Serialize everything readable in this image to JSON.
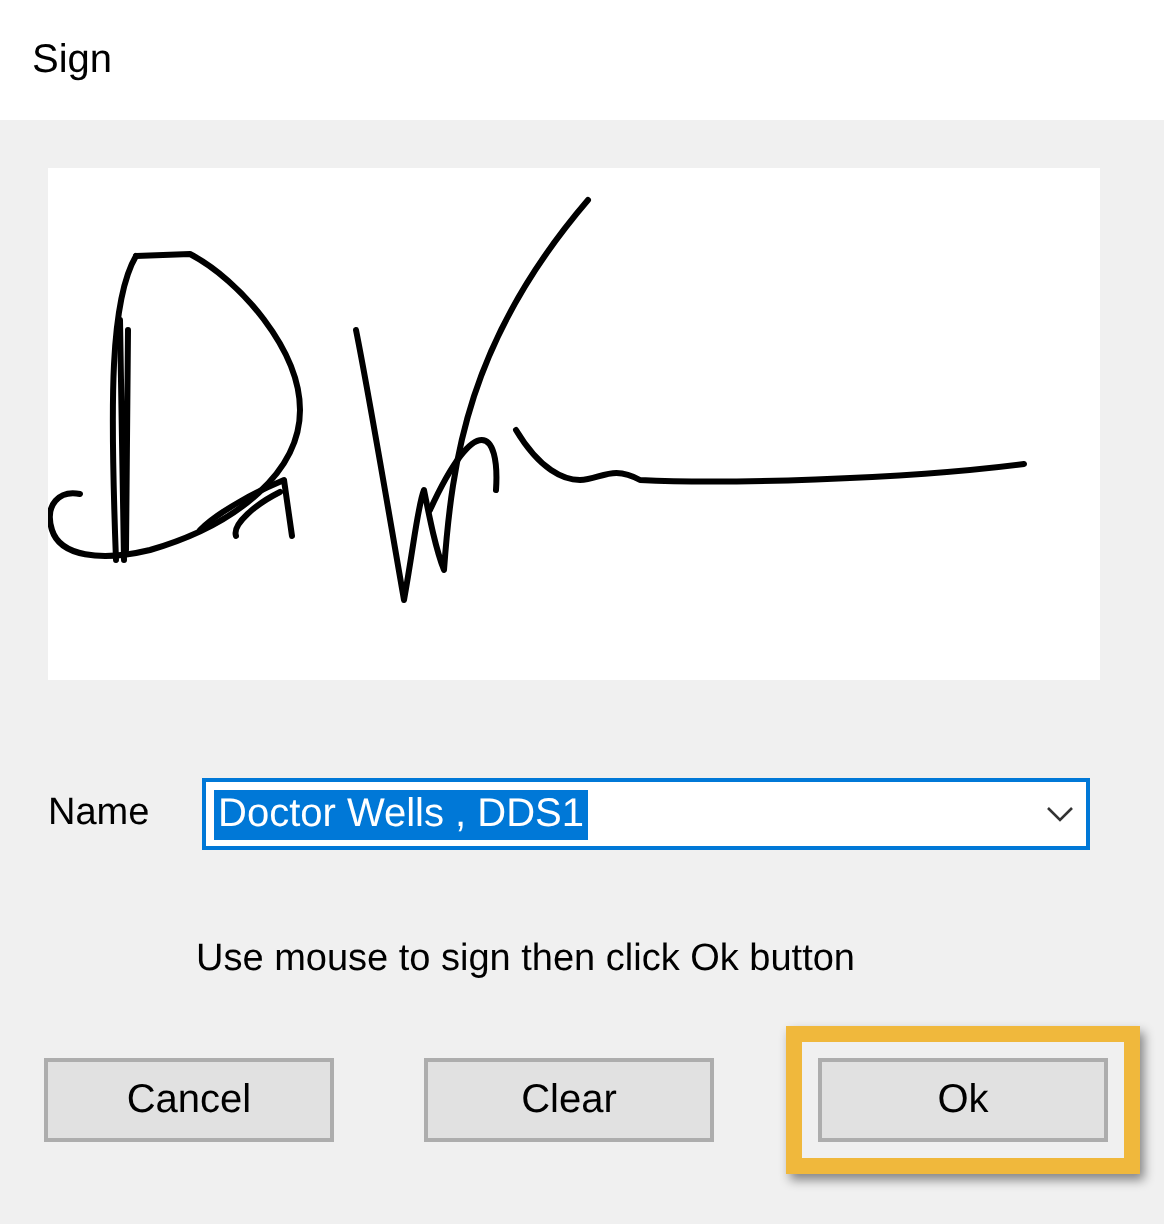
{
  "window": {
    "title": "Sign"
  },
  "name_field": {
    "label": "Name",
    "value": "Doctor Wells , DDS1",
    "text_selected": true,
    "focused": true
  },
  "hint": "Use mouse to sign then click Ok button",
  "buttons": [
    {
      "label": "Cancel",
      "highlighted": false
    },
    {
      "label": "Clear",
      "highlighted": false
    },
    {
      "label": "Ok",
      "highlighted": true
    }
  ]
}
